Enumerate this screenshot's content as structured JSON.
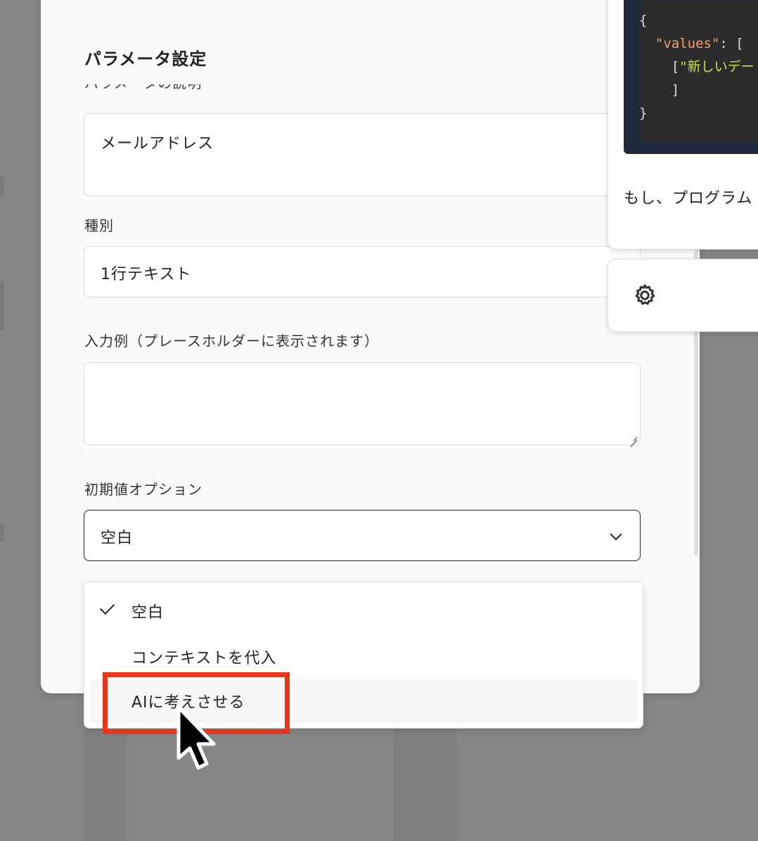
{
  "modal": {
    "title": "パラメータ設定",
    "fields": {
      "description_label": "パラメータの説明",
      "description_value": "メールアドレス",
      "type_label": "種別",
      "type_value": "1行テキスト",
      "placeholder_label": "入力例（プレースホルダーに表示されます）",
      "placeholder_value": "",
      "default_label": "初期値オプション",
      "default_value": "空白"
    }
  },
  "dropdown": {
    "options": [
      {
        "label": "空白",
        "selected": true
      },
      {
        "label": "コンテキストを代入",
        "selected": false
      },
      {
        "label": "AIに考えさせる",
        "selected": false,
        "hovered": true
      }
    ]
  },
  "side_panel": {
    "code": {
      "line1": "{",
      "key": "\"values\"",
      "colon": ": [",
      "line3_prefix": "  [",
      "line3_string": "\"新しいデー",
      "line4": "  ]",
      "line5": "}"
    },
    "text": "もし、プログラム"
  },
  "icons": [
    "check-icon",
    "chevron-down-icon",
    "gear-icon",
    "resize-grip-icon",
    "mouse-cursor"
  ],
  "colors": {
    "highlight": "#e8361c",
    "code_bg": "#2b2b2b",
    "code_key": "#f2a172",
    "code_string": "#c9e34f"
  }
}
